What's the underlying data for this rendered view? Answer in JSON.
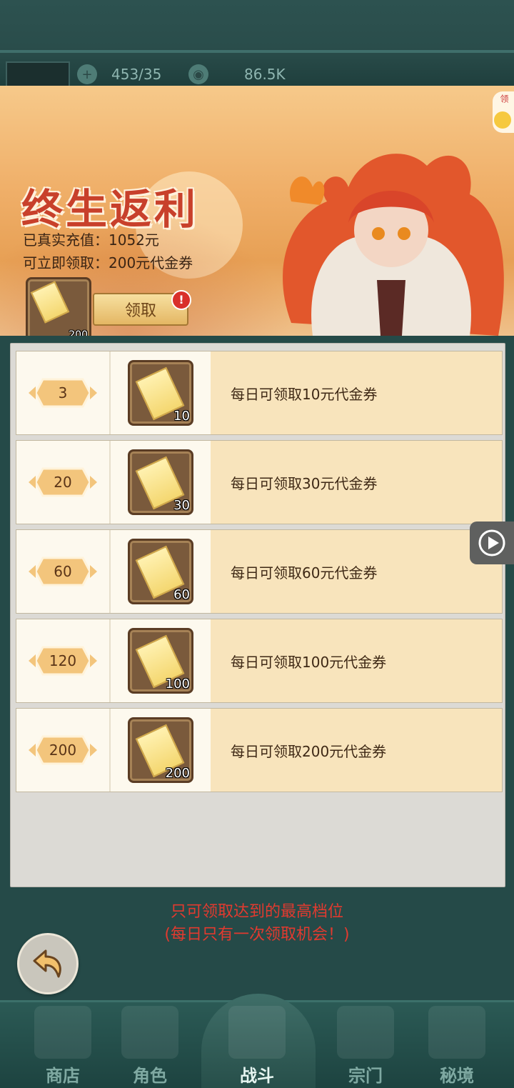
{
  "status": {
    "stamina": "453/35",
    "currency": "86.5K"
  },
  "banner": {
    "title": "终生返利",
    "recharged_label": "已真实充值：1052元",
    "claimable_label": "可立即领取：200元代金券",
    "ticket_count": "200",
    "claim_button": "领取",
    "claim_badge": "!",
    "side_tag": "领"
  },
  "tiers": [
    {
      "amount": "3",
      "count": "10",
      "desc": "每日可领取10元代金券"
    },
    {
      "amount": "20",
      "count": "30",
      "desc": "每日可领取30元代金券"
    },
    {
      "amount": "60",
      "count": "60",
      "desc": "每日可领取60元代金券"
    },
    {
      "amount": "120",
      "count": "100",
      "desc": "每日可领取100元代金券"
    },
    {
      "amount": "200",
      "count": "200",
      "desc": "每日可领取200元代金券"
    }
  ],
  "notice": {
    "line1": "只可领取达到的最高档位",
    "line2": "(每日只有一次领取机会！)"
  },
  "nav": {
    "shop": "商店",
    "role": "角色",
    "battle": "战斗",
    "sect": "宗门",
    "secret": "秘境"
  },
  "icons": {
    "stamina": "stamina-icon",
    "currency": "dragon-coin-icon",
    "back": "back-arrow-icon",
    "video": "play-video-icon",
    "ticket": "voucher-ticket-icon"
  },
  "colors": {
    "accent_red": "#e23a2f",
    "row_desc_bg": "#f8e4bc",
    "nav_bg": "#2b5a55"
  }
}
